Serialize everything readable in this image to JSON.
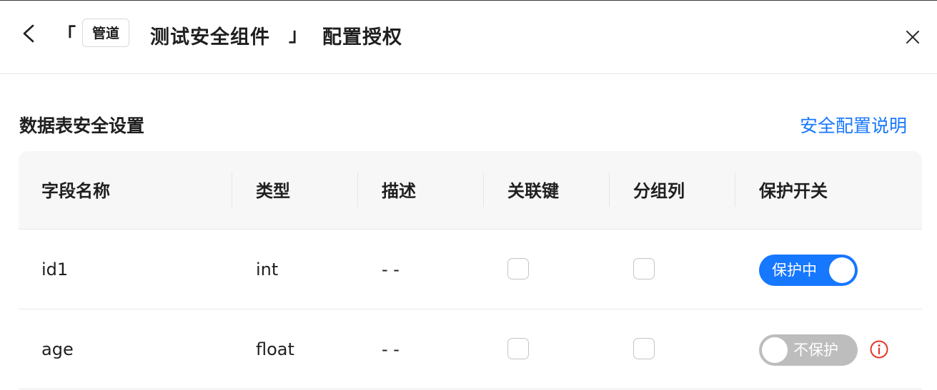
{
  "header": {
    "bracket_open": "「",
    "tag": "管道",
    "component_name": "测试安全组件",
    "bracket_close": "」",
    "title_suffix": "配置授权"
  },
  "section": {
    "title": "数据表安全设置",
    "help_link": "安全配置说明"
  },
  "table": {
    "columns": [
      "字段名称",
      "类型",
      "描述",
      "关联键",
      "分组列",
      "保护开关"
    ],
    "rows": [
      {
        "name": "id1",
        "type": "int",
        "desc": "- -",
        "join_key": false,
        "group_col": false,
        "protect": true,
        "protect_label": "保护中"
      },
      {
        "name": "age",
        "type": "float",
        "desc": "- -",
        "join_key": false,
        "group_col": false,
        "protect": false,
        "protect_label": "不保护"
      }
    ]
  },
  "colors": {
    "accent": "#1677ff",
    "warning": "#e5372b",
    "toggle_off": "#bdbdbd"
  },
  "icons": {
    "back": "chevron-left-icon",
    "close": "close-icon",
    "info": "info-circle-icon"
  }
}
